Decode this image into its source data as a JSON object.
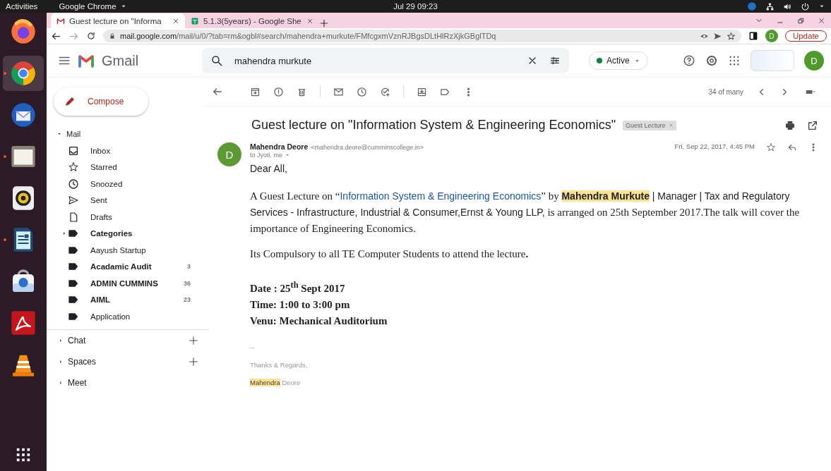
{
  "top_bar": {
    "activities": "Activities",
    "app_menu": "Google Chrome",
    "clock": "Jul 29  09:23"
  },
  "dock": [
    {
      "kind": "firefox",
      "selected": false,
      "running": false
    },
    {
      "kind": "chrome",
      "selected": true,
      "running": true
    },
    {
      "kind": "thunderbird",
      "selected": false,
      "running": false
    },
    {
      "kind": "files",
      "selected": false,
      "running": true
    },
    {
      "kind": "rhythmbox",
      "selected": false,
      "running": false
    },
    {
      "kind": "writer",
      "selected": false,
      "running": true
    },
    {
      "kind": "software",
      "selected": false,
      "running": false
    },
    {
      "kind": "pdf",
      "selected": false,
      "running": false
    },
    {
      "kind": "vlc",
      "selected": false,
      "running": false
    }
  ],
  "browser": {
    "tabs": [
      {
        "kind": "gmail",
        "title": "Guest lecture on \"Informa",
        "selected": true
      },
      {
        "kind": "sheets",
        "title": "5.1.3(5years) - Google She",
        "selected": false
      }
    ],
    "url_host": "mail.google.com",
    "url_path": "/mail/u/0/?tab=rm&ogbl#search/mahendra+murkute/FMfcgxmVznRJBgsDLtHlRzXjkGBglTDq",
    "profile_initial": "D",
    "update_button": "Update"
  },
  "gmail": {
    "logo_text": "Gmail",
    "search_value": "mahendra murkute",
    "status": "Active",
    "account_initial": "D",
    "compose": "Compose",
    "mail_section": "Mail",
    "nav": [
      {
        "kind": "inbox",
        "label": "Inbox",
        "unread": false,
        "expander": false
      },
      {
        "kind": "star",
        "label": "Starred",
        "unread": false,
        "expander": false
      },
      {
        "kind": "clock",
        "label": "Snoozed",
        "unread": false,
        "expander": false
      },
      {
        "kind": "send",
        "label": "Sent",
        "unread": false,
        "expander": false
      },
      {
        "kind": "file",
        "label": "Drafts",
        "unread": false,
        "expander": false
      },
      {
        "kind": "label",
        "label": "Categories",
        "unread": true,
        "expander": true
      },
      {
        "kind": "label",
        "label": "Aayush Startup",
        "unread": false,
        "expander": false
      },
      {
        "kind": "label",
        "label": "Acadamic Audit",
        "unread": true,
        "expander": false,
        "count": "3"
      },
      {
        "kind": "label",
        "label": "ADMIN CUMMINS",
        "unread": true,
        "expander": false,
        "count": "36"
      },
      {
        "kind": "label",
        "label": "AIML",
        "unread": true,
        "expander": false,
        "count": "23"
      },
      {
        "kind": "label",
        "label": "Application",
        "unread": false,
        "expander": false
      }
    ],
    "sections": [
      {
        "label": "Chat",
        "addable": true
      },
      {
        "label": "Spaces",
        "addable": true
      },
      {
        "label": "Meet",
        "addable": false
      }
    ],
    "pager": "34 of many",
    "subject": "Guest lecture on \"Information System & Engineering Economics\"",
    "label_chip": "Guest Lecture",
    "sender_name": "Mahendra Deore",
    "sender_email": "<mahendra.deore@cumminscollege.in>",
    "recipients": "to Jyoti, me",
    "sender_initial": "D",
    "date": "Fri, Sep 22, 2017, 4:45 PM",
    "greeting": "Dear All,",
    "paragraph": [
      {
        "kind": "serif",
        "text": "A Guest Lecture on “"
      },
      {
        "kind": "link",
        "text": "Information System & Engineering Economics"
      },
      {
        "kind": "serif",
        "text": "” by "
      },
      {
        "kind": "highlight",
        "text": "Mahendra Murkute"
      },
      {
        "kind": "sans",
        "text": " | Manager | Tax and Regulatory Services - Infrastructure, Industrial & Consumer,Ernst & Young LLP, "
      },
      {
        "kind": "serif",
        "text": "is arranged on 25th September 2017.The talk will cover the importance of Engineering Economics."
      }
    ],
    "notice": "Its Compulsory to all TE Computer Students to attend the lecture**.**",
    "details": [
      "Date : 25$^{th}$ Sept 2017",
      "Time: 1:00 to 3:00 pm",
      "Venu: Mechanical Auditorium"
    ],
    "signature_dash": "--",
    "signoff": "Thanks & Regards,",
    "signature_first": "Mahendra",
    "signature_last": "Deore"
  }
}
